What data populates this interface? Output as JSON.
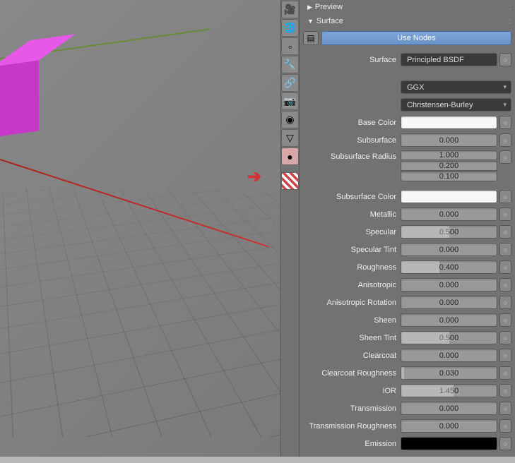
{
  "panels": {
    "preview": {
      "title": "Preview",
      "expanded": false
    },
    "surface": {
      "title": "Surface",
      "expanded": true
    }
  },
  "use_nodes_label": "Use Nodes",
  "surface_dropdown": {
    "label": "Surface",
    "value": "Principled BSDF"
  },
  "distribution": "GGX",
  "sss_method": "Christensen-Burley",
  "properties": {
    "base_color": {
      "label": "Base Color",
      "hex": "#f8f8f8"
    },
    "subsurface": {
      "label": "Subsurface",
      "value": "0.000",
      "fill": 0
    },
    "subsurface_radius": {
      "label": "Subsurface Radius",
      "values": [
        "1.000",
        "0.200",
        "0.100"
      ]
    },
    "subsurface_color": {
      "label": "Subsurface Color",
      "hex": "#f8f8f8"
    },
    "metallic": {
      "label": "Metallic",
      "value": "0.000",
      "fill": 0
    },
    "specular": {
      "label": "Specular",
      "value": "0.500",
      "fill": 50
    },
    "specular_tint": {
      "label": "Specular Tint",
      "value": "0.000",
      "fill": 0
    },
    "roughness": {
      "label": "Roughness",
      "value": "0.400",
      "fill": 40
    },
    "anisotropic": {
      "label": "Anisotropic",
      "value": "0.000",
      "fill": 0
    },
    "anisotropic_rotation": {
      "label": "Anisotropic Rotation",
      "value": "0.000",
      "fill": 0
    },
    "sheen": {
      "label": "Sheen",
      "value": "0.000",
      "fill": 0
    },
    "sheen_tint": {
      "label": "Sheen Tint",
      "value": "0.500",
      "fill": 50
    },
    "clearcoat": {
      "label": "Clearcoat",
      "value": "0.000",
      "fill": 0
    },
    "clearcoat_roughness": {
      "label": "Clearcoat Roughness",
      "value": "0.030",
      "fill": 3
    },
    "ior": {
      "label": "IOR",
      "value": "1.450",
      "fill": 55
    },
    "transmission": {
      "label": "Transmission",
      "value": "0.000",
      "fill": 0
    },
    "transmission_roughness": {
      "label": "Transmission Roughness",
      "value": "0.000",
      "fill": 0
    },
    "emission": {
      "label": "Emission",
      "hex": "#000000"
    }
  },
  "tool_icons": [
    "🎨",
    "🌐",
    "📦",
    "🔧",
    "🔗",
    "📷",
    "🔵",
    "💚",
    "🔴"
  ]
}
